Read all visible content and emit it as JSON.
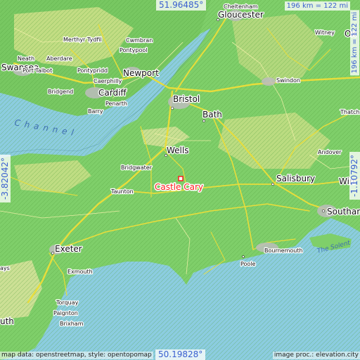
{
  "marker": {
    "name": "Castle Cary",
    "color": "#ff2020"
  },
  "coords": {
    "top": "51.96485°",
    "bottom": "50.19828°",
    "left": "-3.82042°",
    "right": "-1.10792°"
  },
  "scale": {
    "horizontal": "196 km = 122 mi",
    "vertical": "196 km = 122 mi"
  },
  "attribution": {
    "left": "map data: openstreetmap, style: opentopomap",
    "right": "image proc.: elevation.city"
  },
  "sea_labels": {
    "channel": "Channel",
    "solent": "The Solent"
  },
  "places": [
    {
      "name": "Cheltenham",
      "size": "small"
    },
    {
      "name": "Gloucester",
      "size": "big"
    },
    {
      "name": "Witney",
      "size": "small"
    },
    {
      "name": "Merthyr Tydfil",
      "size": "small"
    },
    {
      "name": "Cwmbran",
      "size": "small"
    },
    {
      "name": "Pontypool",
      "size": "small"
    },
    {
      "name": "Neath",
      "size": "small"
    },
    {
      "name": "Aberdare",
      "size": "small"
    },
    {
      "name": "Swansea",
      "size": "big"
    },
    {
      "name": "Port Talbot",
      "size": "small"
    },
    {
      "name": "Pontypridd",
      "size": "small"
    },
    {
      "name": "Newport",
      "size": "big"
    },
    {
      "name": "Caerphilly",
      "size": "small"
    },
    {
      "name": "Bridgend",
      "size": "small"
    },
    {
      "name": "Cardiff",
      "size": "big"
    },
    {
      "name": "Penarth",
      "size": "small"
    },
    {
      "name": "Barry",
      "size": "small"
    },
    {
      "name": "Bristol",
      "size": "big"
    },
    {
      "name": "Swindon",
      "size": "small"
    },
    {
      "name": "Bath",
      "size": "big"
    },
    {
      "name": "Thatcham",
      "size": "small"
    },
    {
      "name": "Wells",
      "size": "big"
    },
    {
      "name": "Andover",
      "size": "small"
    },
    {
      "name": "Bridgwater",
      "size": "small"
    },
    {
      "name": "Salisbury",
      "size": "big"
    },
    {
      "name": "Taunton",
      "size": "small"
    },
    {
      "name": "Southampton",
      "size": "big"
    },
    {
      "name": "Bournemouth",
      "size": "small"
    },
    {
      "name": "Exeter",
      "size": "big"
    },
    {
      "name": "Exmouth",
      "size": "small"
    },
    {
      "name": "Poole",
      "size": "small"
    },
    {
      "name": "Torquay",
      "size": "small"
    },
    {
      "name": "Paignton",
      "size": "small"
    },
    {
      "name": "Brixham",
      "size": "small"
    },
    {
      "name": "Win",
      "size": "big"
    },
    {
      "name": "Ox",
      "size": "big"
    },
    {
      "name": "uth",
      "size": "big"
    },
    {
      "name": "ays",
      "size": "small"
    }
  ],
  "colors": {
    "sea": "#8ccde0",
    "lowland": "#7fcf6a",
    "highland": "#dfe39a",
    "roads": "#e8dd3b",
    "urban": "#c0c0c0"
  }
}
